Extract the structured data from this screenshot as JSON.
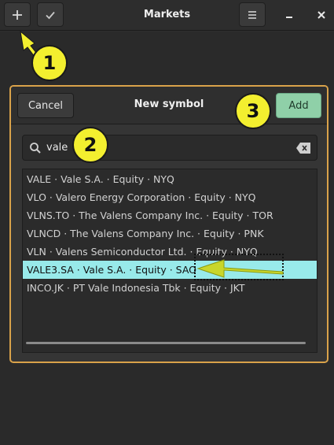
{
  "window": {
    "title": "Markets",
    "add_icon": "plus-icon",
    "select_icon": "checkmark-icon",
    "menu_icon": "hamburger-menu-icon",
    "minimize_icon": "minimize-icon",
    "close_icon": "close-icon"
  },
  "dialog": {
    "title": "New symbol",
    "cancel_label": "Cancel",
    "add_label": "Add",
    "search": {
      "value": "vale",
      "icon": "search-icon",
      "clear_icon": "clear-text-icon"
    },
    "results": [
      "VALE · Vale S.A. · Equity · NYQ",
      "VLO · Valero Energy Corporation · Equity · NYQ",
      "VLNS.TO · The Valens Company Inc. · Equity · TOR",
      "VLNCD · The Valens Company Inc. · Equity · PNK",
      "VLN · Valens Semiconductor Ltd. · Equity · NYQ",
      "VALE3.SA · Vale S.A. · Equity · SAO",
      "INCO.JK · PT Vale Indonesia Tbk · Equity · JKT"
    ],
    "selected_index": 5
  },
  "annotations": {
    "step1": "1",
    "step2": "2",
    "step3": "3"
  },
  "colors": {
    "accent_border": "#d9a24a",
    "add_button": "#8fd0a8",
    "selected_row": "#98eaea",
    "annotation_yellow": "#f3ef2f"
  }
}
